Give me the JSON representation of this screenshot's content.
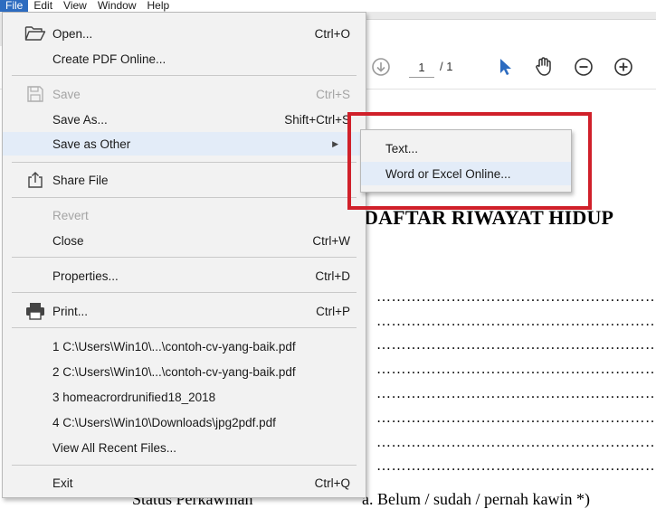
{
  "menubar": {
    "items": [
      "File",
      "Edit",
      "View",
      "Window",
      "Help"
    ],
    "active": "File"
  },
  "toolbar": {
    "page_current": "1",
    "page_total": "/ 1"
  },
  "file_menu": {
    "open": {
      "label": "Open...",
      "shortcut": "Ctrl+O"
    },
    "create_pdf_online": {
      "label": "Create PDF Online..."
    },
    "save": {
      "label": "Save",
      "shortcut": "Ctrl+S"
    },
    "save_as": {
      "label": "Save As...",
      "shortcut": "Shift+Ctrl+S"
    },
    "save_as_other": {
      "label": "Save as Other"
    },
    "share_file": {
      "label": "Share File"
    },
    "revert": {
      "label": "Revert"
    },
    "close": {
      "label": "Close",
      "shortcut": "Ctrl+W"
    },
    "properties": {
      "label": "Properties...",
      "shortcut": "Ctrl+D"
    },
    "print": {
      "label": "Print...",
      "shortcut": "Ctrl+P"
    },
    "recent": [
      "1 C:\\Users\\Win10\\...\\contoh-cv-yang-baik.pdf",
      "2 C:\\Users\\Win10\\...\\contoh-cv-yang-baik.pdf",
      "3 homeacrordrunified18_2018",
      "4 C:\\Users\\Win10\\Downloads\\jpg2pdf.pdf"
    ],
    "view_all_recent": {
      "label": "View All Recent Files..."
    },
    "exit": {
      "label": "Exit",
      "shortcut": "Ctrl+Q"
    }
  },
  "submenu": {
    "text": "Text...",
    "word_excel_online": "Word or Excel Online..."
  },
  "document": {
    "title": "DAFTAR RIWAYAT HIDUP",
    "dotted_line": "………………………………………………………………",
    "bottom_left": "Status Perkawinan",
    "bottom_right": "a. Belum / sudah / pernah kawin *)"
  },
  "colors": {
    "menu_bg": "#f2f2f2",
    "hover_bg": "#e3ecf8",
    "active_menubar": "#2d6cc0",
    "highlight_red": "#d0202a",
    "disabled_text": "#a4a4a4",
    "pointer_blue": "#2d6cc0"
  }
}
